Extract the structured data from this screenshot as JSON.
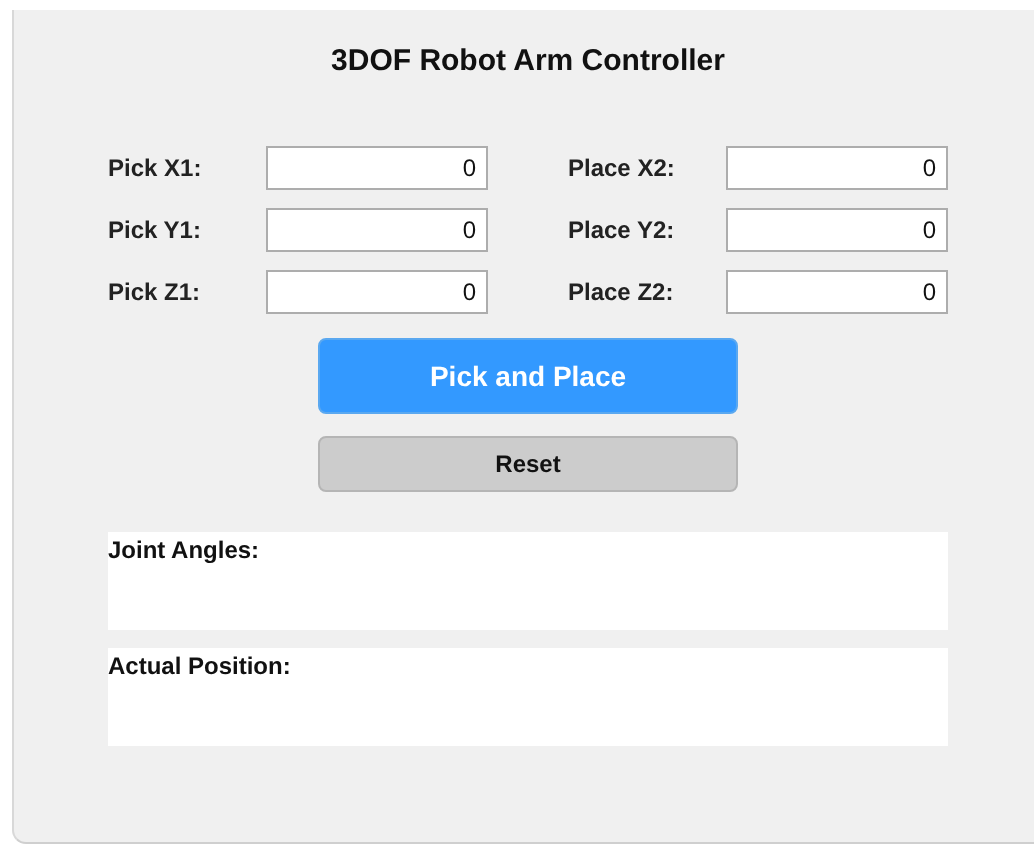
{
  "title": "3DOF Robot Arm Controller",
  "fields": [
    {
      "label": "Pick X1:",
      "value": "0"
    },
    {
      "label": "Place X2:",
      "value": "0"
    },
    {
      "label": "Pick Y1:",
      "value": "0"
    },
    {
      "label": "Place Y2:",
      "value": "0"
    },
    {
      "label": "Pick Z1:",
      "value": "0"
    },
    {
      "label": "Place Z2:",
      "value": "0"
    }
  ],
  "buttons": [
    {
      "label": "Pick and Place",
      "kind": "primary"
    },
    {
      "label": "Reset",
      "kind": "secondary"
    }
  ],
  "outputs": [
    {
      "label": "Joint Angles:"
    },
    {
      "label": "Actual Position:"
    }
  ]
}
